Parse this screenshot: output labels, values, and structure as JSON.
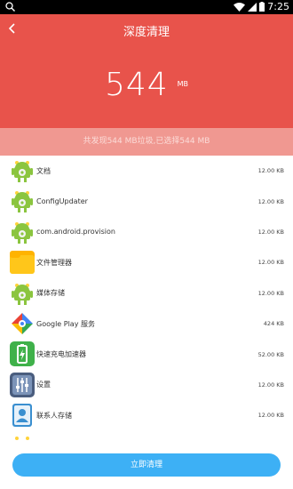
{
  "status_bar": {
    "time": "7:25"
  },
  "header": {
    "title": "深度清理",
    "size_value": "544",
    "size_unit": "MB"
  },
  "summary": {
    "text": "共发现544 MB垃圾,已选择544 MB"
  },
  "items": [
    {
      "name": "文档",
      "size": "12.00 KB",
      "icon": "android-robot-icon"
    },
    {
      "name": "ConfigUpdater",
      "size": "12.00 KB",
      "icon": "android-robot-icon"
    },
    {
      "name": "com.android.provision",
      "size": "12.00 KB",
      "icon": "android-robot-icon"
    },
    {
      "name": "文件管理器",
      "size": "12.00 KB",
      "icon": "folder-icon"
    },
    {
      "name": "媒体存储",
      "size": "12.00 KB",
      "icon": "android-robot-icon"
    },
    {
      "name": "Google Play 服务",
      "size": "424 KB",
      "icon": "google-play-services-icon"
    },
    {
      "name": "快速充电加速器",
      "size": "52.00 KB",
      "icon": "battery-charge-icon"
    },
    {
      "name": "设置",
      "size": "12.00 KB",
      "icon": "settings-sliders-icon"
    },
    {
      "name": "联系人存储",
      "size": "12.00 KB",
      "icon": "contacts-icon"
    }
  ],
  "footer": {
    "clean_button_label": "立即清理"
  },
  "colors": {
    "header": "#e8534b",
    "summary_band": "#f09891",
    "button": "#3db0f5"
  }
}
